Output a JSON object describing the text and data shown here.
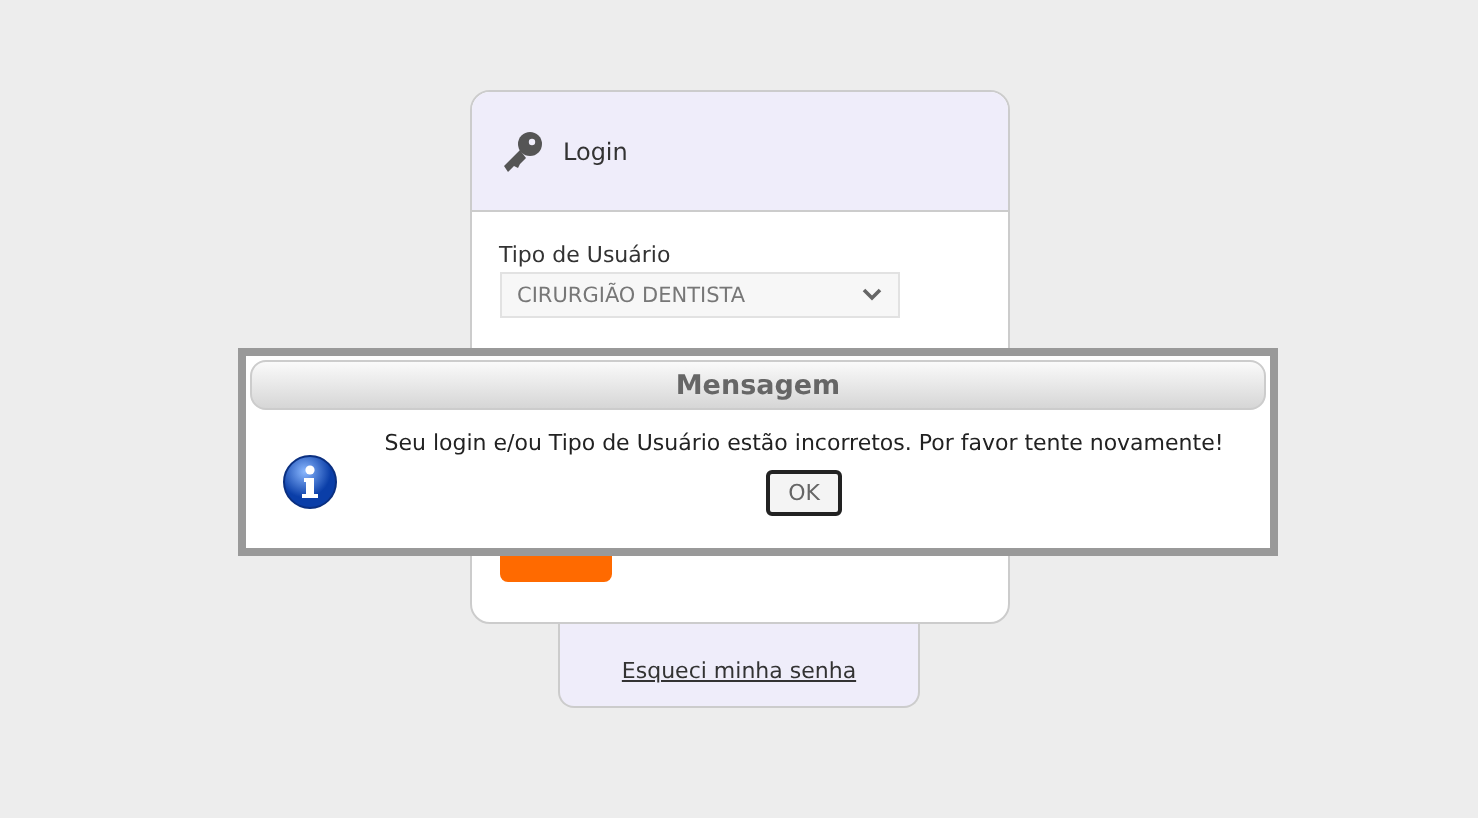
{
  "login_card": {
    "title": "Login",
    "user_type": {
      "label": "Tipo de Usuário",
      "value": "CIRURGIÃO DENTISTA"
    }
  },
  "forgot_link": "Esqueci minha senha",
  "dialog": {
    "title": "Mensagem",
    "message": "Seu login e/ou Tipo de Usuário estão incorretos. Por favor tente novamente!",
    "button": "OK"
  }
}
